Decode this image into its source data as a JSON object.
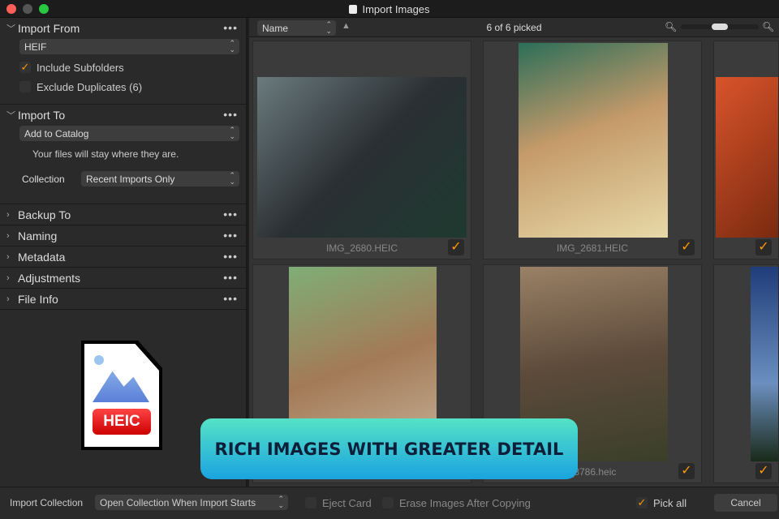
{
  "window": {
    "title": "Import Images"
  },
  "left": {
    "import_from": {
      "label": "Import From",
      "source": "HEIF",
      "include_subfolders": "Include Subfolders",
      "include_checked": true,
      "exclude_duplicates": "Exclude Duplicates (6)",
      "exclude_checked": false
    },
    "import_to": {
      "label": "Import To",
      "destination": "Add to Catalog",
      "note": "Your files will stay where they are.",
      "collection_label": "Collection",
      "collection": "Recent Imports Only"
    },
    "collapsed": [
      {
        "label": "Backup To"
      },
      {
        "label": "Naming"
      },
      {
        "label": "Metadata"
      },
      {
        "label": "Adjustments"
      },
      {
        "label": "File Info"
      }
    ],
    "badge": "HEIC"
  },
  "toolbar": {
    "sort": "Name",
    "picked": "6 of 6 picked",
    "zoom_level": 0.5
  },
  "grid": [
    {
      "name": "IMG_2680.HEIC",
      "picked": true
    },
    {
      "name": "IMG_2681.HEIC",
      "picked": true
    },
    {
      "name": "",
      "picked": true
    },
    {
      "name": "",
      "picked": true
    },
    {
      "name": "_8786.heic",
      "picked": true
    },
    {
      "name": "",
      "picked": true
    }
  ],
  "bottom": {
    "import_collection_label": "Import Collection",
    "import_collection": "Open Collection When Import Starts",
    "eject": "Eject Card",
    "erase": "Erase Images After Copying",
    "pick_all": "Pick all",
    "cancel": "Cancel"
  },
  "banner": {
    "text": "RICH IMAGES WITH GREATER DETAIL"
  },
  "colors": {
    "accent": "#ff9900",
    "banner_top": "#54e3c6",
    "banner_bottom": "#1ba3e0"
  }
}
